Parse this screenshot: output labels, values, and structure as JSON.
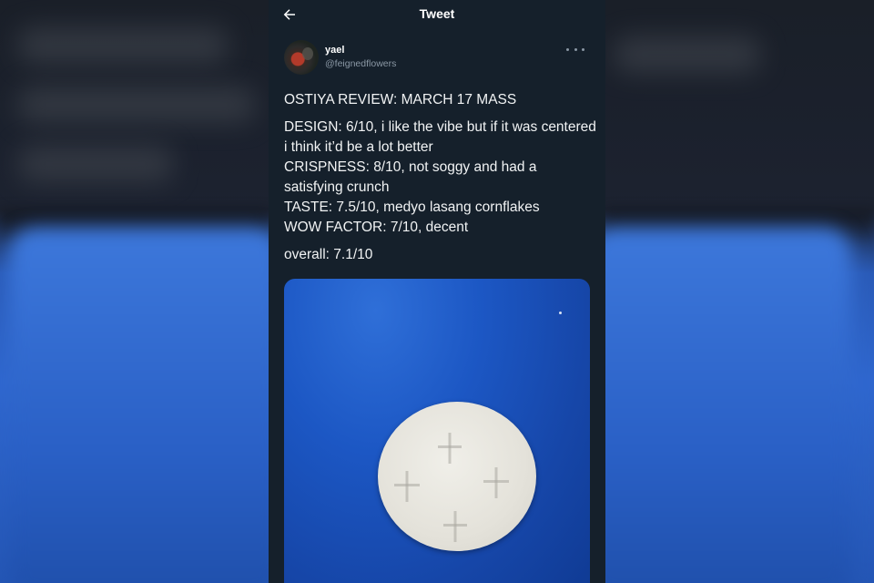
{
  "header": {
    "title": "Tweet",
    "back_icon": "arrow-left-icon"
  },
  "author": {
    "name": "yael",
    "handle": "@feignedflowers",
    "more_icon": "more-horizontal-icon"
  },
  "tweet": {
    "title_line": "OSTIYA REVIEW: MARCH 17 MASS",
    "lines": [
      "DESIGN: 6/10, i like the vibe but if it was centered i think it’d be a lot better",
      "CRISPNESS: 8/10, not soggy and had a satisfying crunch",
      "TASTE: 7.5/10, medyo lasang cornflakes",
      "WOW FACTOR: 7/10, decent"
    ],
    "overall": "overall: 7.1/10"
  },
  "colors": {
    "background": "#15202b",
    "text": "#e7e9ea",
    "secondary_text": "#8b98a5",
    "photo_blue": "#1c57c4"
  }
}
